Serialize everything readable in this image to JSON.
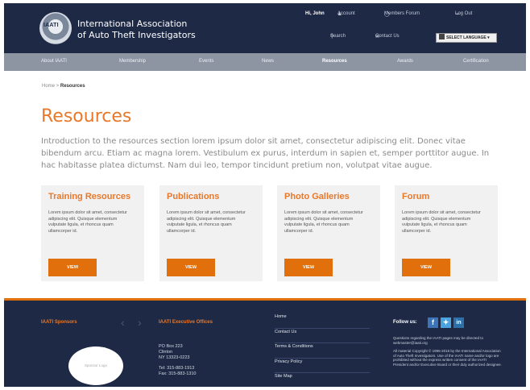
{
  "header": {
    "logo_text": "IAATI",
    "org_name_line1": "International Association",
    "org_name_line2": "of Auto Theft Investigators",
    "greeting": "Hi, John",
    "account": "Account",
    "members_forum": "Members Forum",
    "log_out": "Log Out",
    "search": "Search",
    "contact_us": "Contact Us",
    "language": "SELECT LANGUAGE"
  },
  "nav": [
    "About IAATI",
    "Membership",
    "Events",
    "News",
    "Resources",
    "Awards",
    "Certification"
  ],
  "breadcrumb": {
    "home": "Home",
    "sep": " > ",
    "current": "Resources"
  },
  "page_title": "Resources",
  "intro": "Introduction to the resources section lorem ipsum dolor sit amet, consectetur adipiscing elit. Donec vitae bibendum arcu. Etiam ac magna lorem. Vestibulum ex purus, interdum in sapien et, semper porttitor augue. In hac habitasse platea dictumst. Nam dui leo, tempor tincidunt pretium non, volutpat vitae augue.",
  "cards": [
    {
      "title": "Training Resources",
      "text": "Lorem ipsum dolor sit amet, consectetur adipiscing elit. Quisque elementum vulputate ligula, et rhoncus quam ullamcorper id.",
      "button": "VIEW"
    },
    {
      "title": "Publications",
      "text": "Lorem ipsum dolor sit amet, consectetur adipiscing elit. Quisque elementum vulputate ligula, et rhoncus quam ullamcorper id.",
      "button": "VIEW"
    },
    {
      "title": "Photo Galleries",
      "text": "Lorem ipsum dolor sit amet, consectetur adipiscing elit. Quisque elementum vulputate ligula, et rhoncus quam ullamcorper id.",
      "button": "VIEW"
    },
    {
      "title": "Forum",
      "text": "Lorem ipsum dolor sit amet, consectetur adipiscing elit. Quisque elementum vulputate ligula, et rhoncus quam ullamcorper id.",
      "button": "VIEW"
    }
  ],
  "footer": {
    "sponsors_title": "IAATI Sponsors",
    "sponsor_logo": "Sponsor Logo",
    "offices_title": "IAATI Executive Offices",
    "address": [
      "PO Box 223",
      "Clinton",
      "NY 13323-0223"
    ],
    "phone": [
      "Tel: 315-883-1913",
      "Fax: 315-883-1310"
    ],
    "links": [
      "Home",
      "Contact Us",
      "Terms & Conditions",
      "Privacy Policy",
      "Site Map"
    ],
    "follow_us": "Follow us:",
    "questions": "Questions regarding the IAATI pages may be directed to webmaster@iaati.org",
    "copyright": "All material Copyright © 1995-2016 by the International Association of Auto Theft Investigators. Use of the IAATI name and/or logo are prohibited without the express written consent of the IAATI President and/or Executive Board or their duly authorized designee."
  },
  "colors": {
    "navy": "#1d2945",
    "orange": "#e8782a",
    "nav_gray": "#8d95a3",
    "card_bg": "#f1f1f1"
  }
}
